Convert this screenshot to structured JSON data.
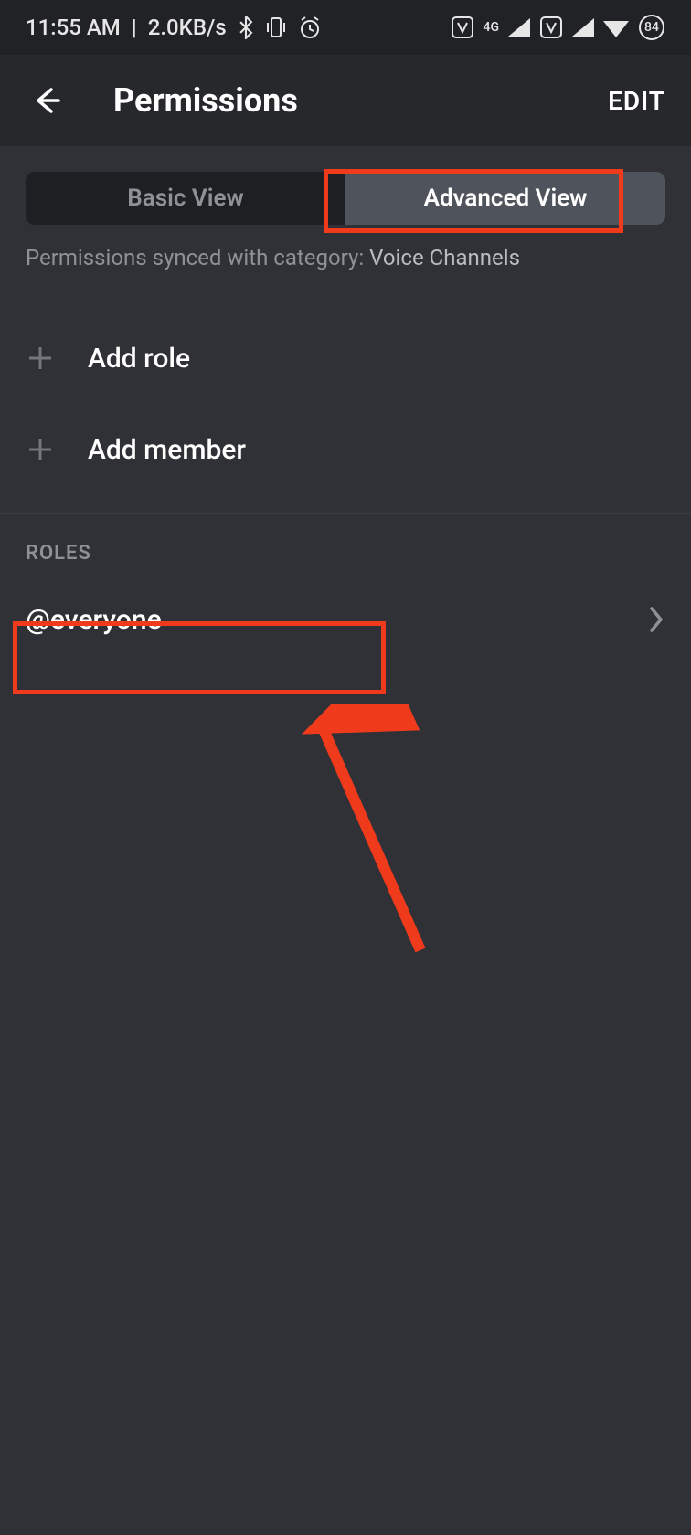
{
  "status_bar": {
    "time": "11:55 AM",
    "separator": "|",
    "speed": "2.0KB/s",
    "battery_percent": "84",
    "network_label": "4G"
  },
  "header": {
    "title": "Permissions",
    "edit_label": "EDIT"
  },
  "tabs": {
    "basic": "Basic View",
    "advanced": "Advanced View"
  },
  "sync_text": {
    "prefix": "Permissions synced with category: ",
    "category": "Voice Channels"
  },
  "add": {
    "role_label": "Add role",
    "member_label": "Add member"
  },
  "roles_section": {
    "heading": "ROLES",
    "items": [
      {
        "label": "@everyone"
      }
    ]
  }
}
